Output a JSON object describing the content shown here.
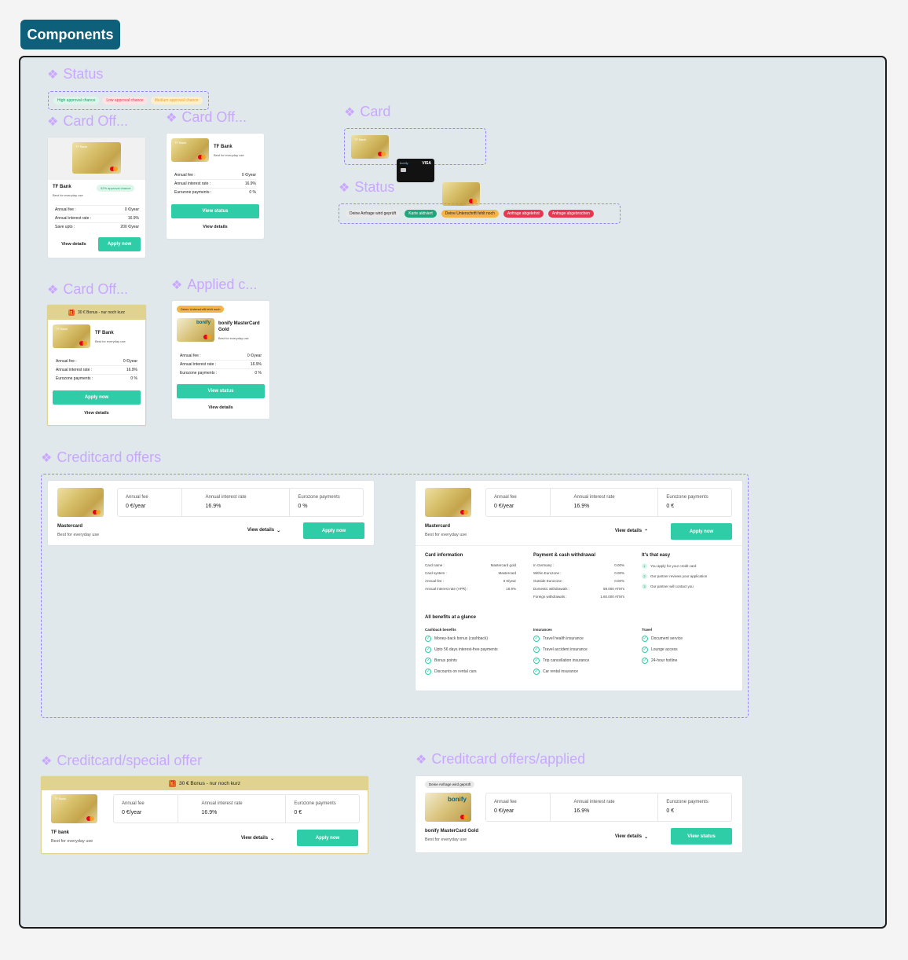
{
  "header": {
    "title": "Components"
  },
  "sections": {
    "status1": "Status",
    "card_off_a": "Card Off...",
    "card_off_b": "Card Off...",
    "card": "Card",
    "status2": "Status",
    "card_off_c": "Card Off...",
    "applied": "Applied c...",
    "creditcard_offers": "Creditcard offers",
    "special_offer": "Creditcard/special offer",
    "offers_applied": "Creditcard offers/applied"
  },
  "status_pills": [
    {
      "label": "High approval chance",
      "bg": "#dcf7ea",
      "fg": "#1c9b6b"
    },
    {
      "label": "Low approval chance",
      "bg": "#fde3e3",
      "fg": "#e2374b"
    },
    {
      "label": "Medium approval chance",
      "bg": "#fdeecf",
      "fg": "#e8a426"
    }
  ],
  "status2_pills": [
    {
      "label": "Deine Anfrage wird geprüft",
      "bg": "#e9e9e9",
      "fg": "#222"
    },
    {
      "label": "Karte aktiviert",
      "bg": "#1fa67a",
      "fg": "#fff"
    },
    {
      "label": "Deine Unterschrift fehlt noch",
      "bg": "#f6b34a",
      "fg": "#222"
    },
    {
      "label": "Anfrage abgelehnt",
      "bg": "#e8384f",
      "fg": "#fff"
    },
    {
      "label": "Anfrage abgebrochen",
      "bg": "#e8384f",
      "fg": "#fff"
    }
  ],
  "offer_a": {
    "brand": "TF Bank",
    "name": "TF Bank",
    "sub": "Best for everyday use",
    "badge": "92% approval chance",
    "rows": [
      [
        "Annual fee :",
        "0 €/year"
      ],
      [
        "Annual interest rate :",
        "16.9%"
      ],
      [
        "Save upto :",
        "200 €/year"
      ]
    ],
    "details": "View details",
    "apply": "Apply now"
  },
  "offer_b": {
    "brand": "TF Bank",
    "name": "TF Bank",
    "sub": "Best for everyday use",
    "rows": [
      [
        "Annual fee :",
        "0 €/year"
      ],
      [
        "Annual interest rate :",
        "16.9%"
      ],
      [
        "Eurozone payments :",
        "0 %"
      ]
    ],
    "status": "View status",
    "details": "View details"
  },
  "offer_c": {
    "bar": "30 € Bonus - nur noch kurz",
    "brand": "TF Bank",
    "name": "TF Bank",
    "sub": "Best for everyday use",
    "rows": [
      [
        "Annual fee :",
        "0 €/year"
      ],
      [
        "Annual interest rate :",
        "16.9%"
      ],
      [
        "Eurozone payments :",
        "0 %"
      ]
    ],
    "apply": "Apply now",
    "details": "View details"
  },
  "applied_card": {
    "pill": "Deine Unterschrift fehlt noch",
    "logo": "bonify",
    "name": "bonify MasterCard Gold",
    "sub": "Best for everyday use",
    "rows": [
      [
        "Annual fee :",
        "0 €/year"
      ],
      [
        "Annual interest rate :",
        "16.9%"
      ],
      [
        "Eurozone payments :",
        "0 %"
      ]
    ],
    "status": "View status",
    "details": "View details"
  },
  "dark_card": {
    "brand": "bonify",
    "network": "VISA"
  },
  "cc_left": {
    "name": "Mastercard",
    "sub": "Best for everyday use",
    "stats": [
      [
        "Annual fee",
        "0 €/year"
      ],
      [
        "Annual interest rate",
        "16.9%"
      ],
      [
        "Eurozone payments",
        "0 %"
      ]
    ],
    "details": "View details",
    "apply": "Apply now"
  },
  "cc_right": {
    "name": "Mastercard",
    "sub": "Best for everyday use",
    "stats": [
      [
        "Annual fee",
        "0 €/year"
      ],
      [
        "Annual interest rate",
        "16.9%"
      ],
      [
        "Eurozone payments",
        "0 €"
      ]
    ],
    "details": "View details",
    "apply": "Apply now",
    "info_title": "Card information",
    "info": [
      [
        "Card name :",
        "Mastercard gold"
      ],
      [
        "Card system :",
        "Mastercard"
      ],
      [
        "Annual fee :",
        "0 €/year"
      ],
      [
        "Annual interest rate (APR) :",
        "16.9%"
      ]
    ],
    "pay_title": "Payment & cash withdrawal",
    "pay": [
      [
        "In Germany :",
        "0.00%"
      ],
      [
        "Within Eurozone :",
        "0.00%"
      ],
      [
        "Outside Eurozone :",
        "0.00%"
      ],
      [
        "Domestic withdrawals :",
        "58.000 ATM's"
      ],
      [
        "Foreign withdrawals :",
        "1.60.000 ATM's"
      ]
    ],
    "easy_title": "It's that easy",
    "easy": [
      "You apply for your credit card",
      "Our partner reviews your application",
      "Our partner will contact you"
    ],
    "benefits_title": "All benefits at a glance",
    "cashback_title": "Cashback benefits",
    "cashback": [
      "Money-back bonus (cashback)",
      "Upto 56 days interest-free payments",
      "Bonus points",
      "Discounts on rental cars"
    ],
    "ins_title": "Insurances",
    "ins": [
      "Travel health insurance",
      "Travel accident insurance",
      "Trip cancellation insurance",
      "Car rental insurance"
    ],
    "travel_title": "Travel",
    "travel": [
      "Document service",
      "Lounge access",
      "24-hour hotline"
    ]
  },
  "special": {
    "bar": "30 € Bonus - nur noch kurz",
    "brand": "TF Bank",
    "name": "TF bank",
    "sub": "Best for everyday use",
    "stats": [
      [
        "Annual fee",
        "0 €/year"
      ],
      [
        "Annual interest rate",
        "16.9%"
      ],
      [
        "Eurozone payments",
        "0 €"
      ]
    ],
    "details": "View details",
    "apply": "Apply now"
  },
  "applied_wide": {
    "pill": "Deine Anfrage wird geprüft",
    "logo": "bonify",
    "name": "bonify MasterCard Gold",
    "sub": "Best for everyday use",
    "stats": [
      [
        "Annual fee",
        "0 €/year"
      ],
      [
        "Annual interest rate",
        "16.9%"
      ],
      [
        "Eurozone payments",
        "0 €"
      ]
    ],
    "details": "View details",
    "status": "View status"
  }
}
